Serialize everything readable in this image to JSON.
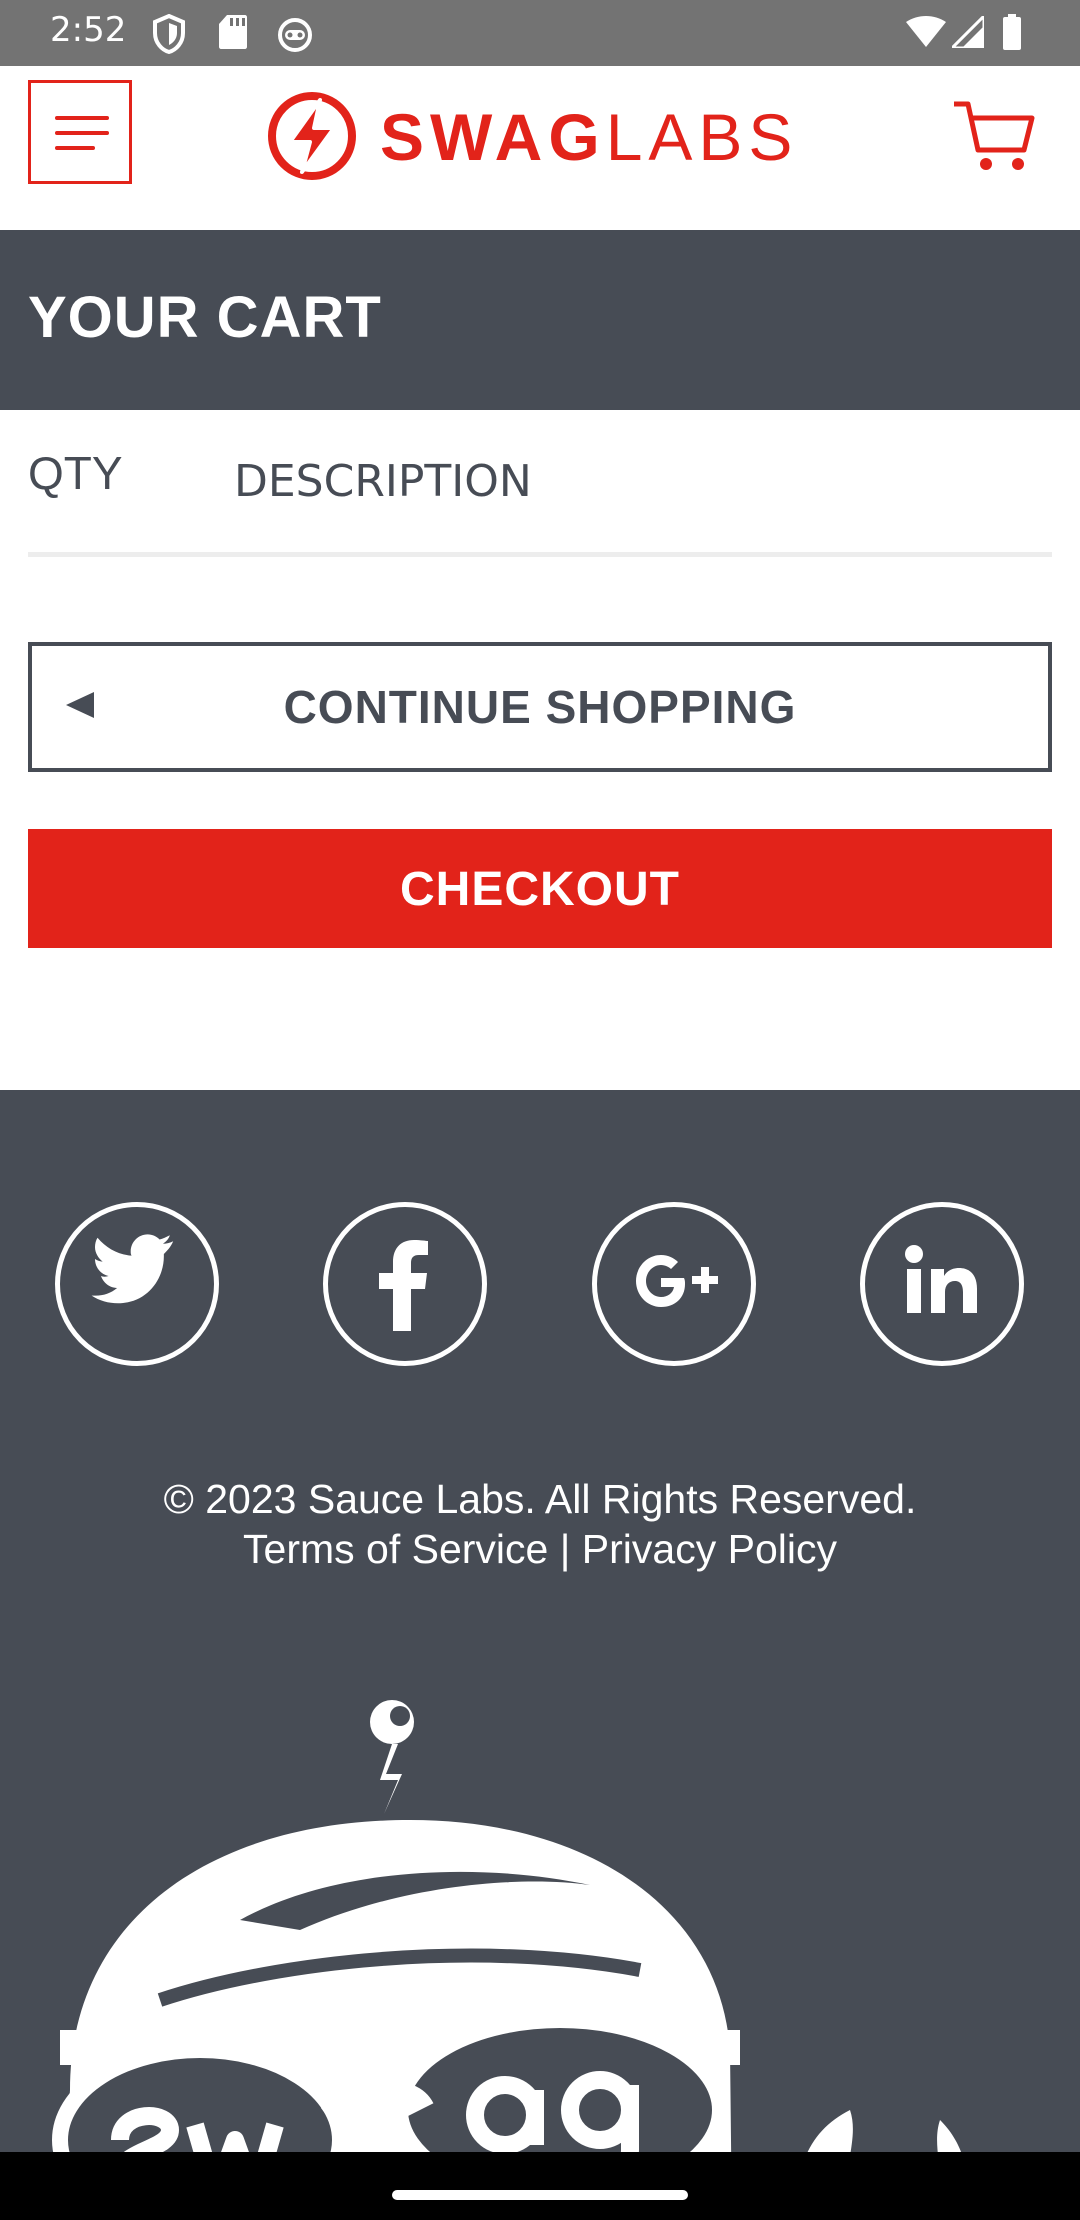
{
  "status_bar": {
    "time": "2:52",
    "icons_left": [
      "shield-icon",
      "sd-card-icon",
      "robot-icon"
    ],
    "icons_right": [
      "wifi-icon",
      "signal-icon",
      "battery-icon"
    ]
  },
  "header": {
    "menu_icon": "hamburger-menu-icon",
    "logo_bold": "SWAG",
    "logo_light": "LABS",
    "brand_color": "#e2231a",
    "cart_icon": "shopping-cart-icon"
  },
  "page": {
    "title": "YOUR CART"
  },
  "cart": {
    "qty_header": "QTY",
    "description_header": "DESCRIPTION",
    "items": []
  },
  "actions": {
    "continue_shopping": "CONTINUE SHOPPING",
    "checkout": "CHECKOUT"
  },
  "footer": {
    "social": [
      "twitter-icon",
      "facebook-icon",
      "google-plus-icon",
      "linkedin-icon"
    ],
    "copyright": "© 2023 Sauce Labs. All Rights Reserved.",
    "terms": "Terms of Service",
    "separator": "|",
    "privacy": "Privacy Policy",
    "background_color": "#474c55"
  }
}
